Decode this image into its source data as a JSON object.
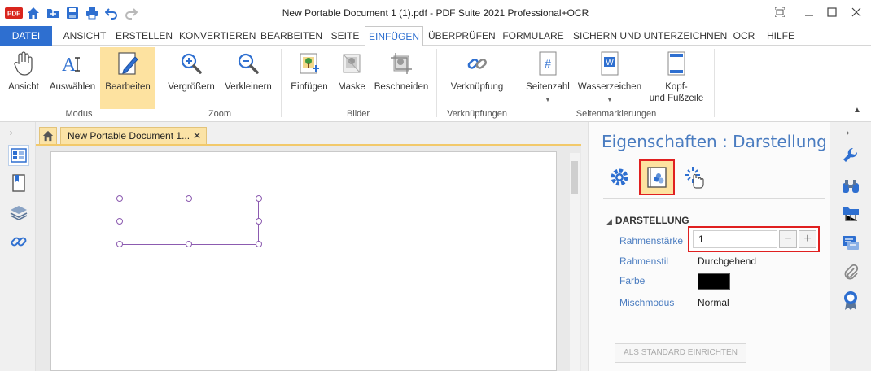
{
  "window": {
    "title": "New Portable Document 1 (1).pdf   -   PDF Suite 2021  Professional+OCR"
  },
  "quick_access": {
    "logo_text": "PDF"
  },
  "menu": {
    "items": [
      "DATEI",
      "ANSICHT",
      "ERSTELLEN",
      "KONVERTIEREN",
      "BEARBEITEN",
      "SEITE",
      "EINFÜGEN",
      "ÜBERPRÜFEN",
      "FORMULARE",
      "SICHERN UND UNTERZEICHNEN",
      "OCR",
      "HILFE"
    ],
    "active": "EINFÜGEN"
  },
  "ribbon": {
    "modus": {
      "label": "Modus",
      "ansicht": "Ansicht",
      "auswaehlen": "Auswählen",
      "bearbeiten": "Bearbeiten"
    },
    "zoom": {
      "label": "Zoom",
      "vergroessern": "Vergrößern",
      "verkleinern": "Verkleinern"
    },
    "bilder": {
      "label": "Bilder",
      "einfuegen": "Einfügen",
      "maske": "Maske",
      "beschneiden": "Beschneiden"
    },
    "verknuepfungen": {
      "label": "Verknüpfungen",
      "verknuepfung": "Verknüpfung"
    },
    "seitenmarkierungen": {
      "label": "Seitenmarkierungen",
      "seitenzahl": "Seitenzahl",
      "wasserzeichen": "Wasserzeichen",
      "kopf_line1": "Kopf-",
      "kopf_line2": "und Fußzeile"
    }
  },
  "tabs": {
    "document": "New Portable Document 1...",
    "close": "✕"
  },
  "panel": {
    "title": "Eigenschaften : Darstellung",
    "section": "DARSTELLUNG",
    "rows": {
      "rahmenstaerke": "Rahmenstärke",
      "rahmenstil": "Rahmenstil",
      "rahmenstil_value": "Durchgehend",
      "farbe": "Farbe",
      "farbe_value": "#000000",
      "mischmodus": "Mischmodus",
      "mischmodus_value": "Normal"
    },
    "border_width_value": "1",
    "minus": "−",
    "plus": "+",
    "standard_button": "ALS STANDARD EINRICHTEN"
  },
  "colors": {
    "accent_blue": "#2e6fd0",
    "selection_yellow": "#fde2a0",
    "highlight_red": "#e02020",
    "shape_purple": "#8c5bb0"
  }
}
